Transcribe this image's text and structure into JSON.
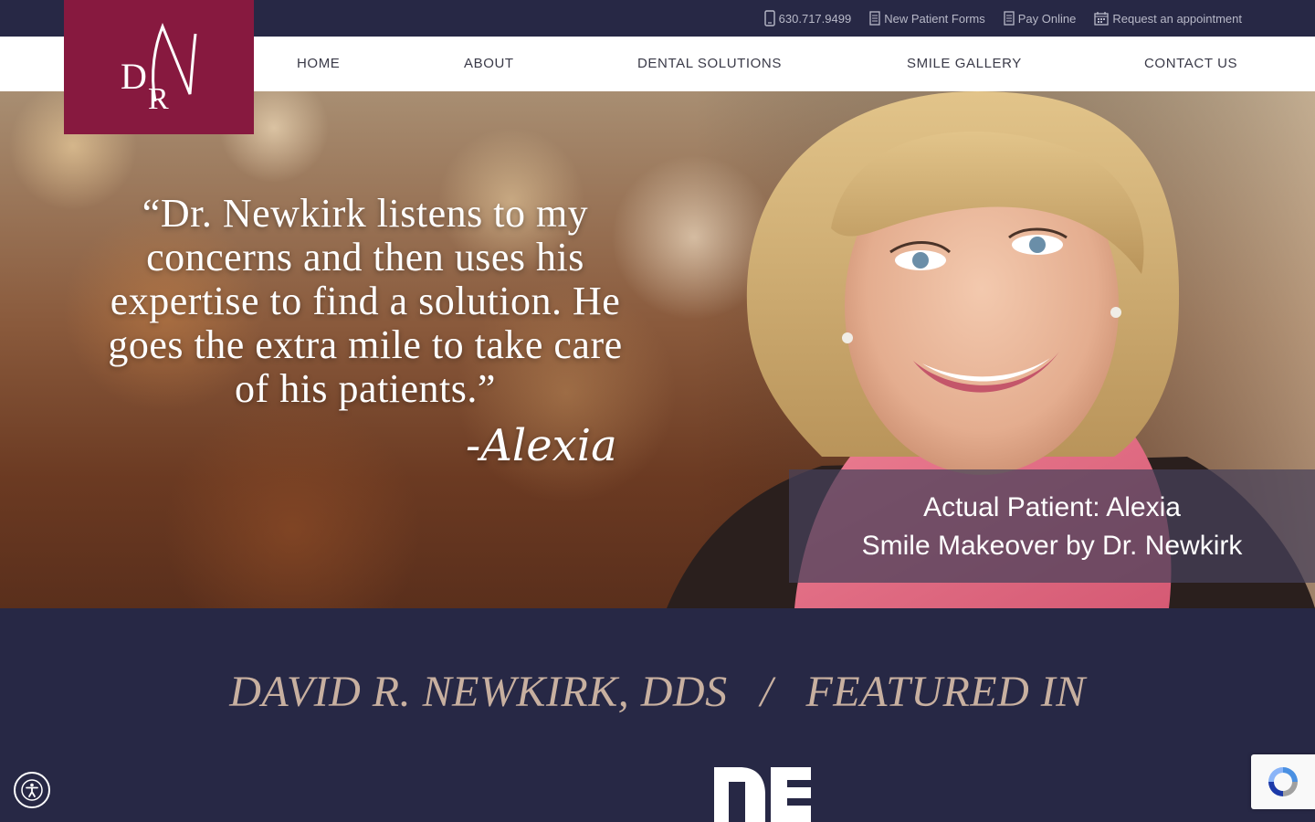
{
  "utility": {
    "phone": "630.717.9499",
    "forms": "New Patient Forms",
    "pay": "Pay Online",
    "appointment": "Request an appointment"
  },
  "nav": {
    "home": "HOME",
    "about": "ABOUT",
    "solutions": "DENTAL SOLUTIONS",
    "gallery": "SMILE GALLERY",
    "contact": "CONTACT US"
  },
  "logo": {
    "initials": "DNR",
    "color": "#87193f"
  },
  "hero": {
    "quote": "“Dr. Newkirk listens to my concerns and then uses his expertise to find a solution. He goes the extra mile to take care of his patients.”",
    "signature": "-Alexia",
    "caption_line1": "Actual Patient: Alexia",
    "caption_line2": "Smile Makeover by Dr. Newkirk"
  },
  "featured": {
    "name": "DAVID R. NEWKIRK, DDS",
    "separator": "/",
    "label": "FEATURED IN",
    "publication_logo": "DE"
  },
  "colors": {
    "navy": "#272845",
    "burgundy": "#87193f",
    "accent_text": "#c8b0a0"
  },
  "icons": [
    "phone-icon",
    "document-icon",
    "calendar-icon",
    "accessibility-icon",
    "recaptcha-icon"
  ]
}
